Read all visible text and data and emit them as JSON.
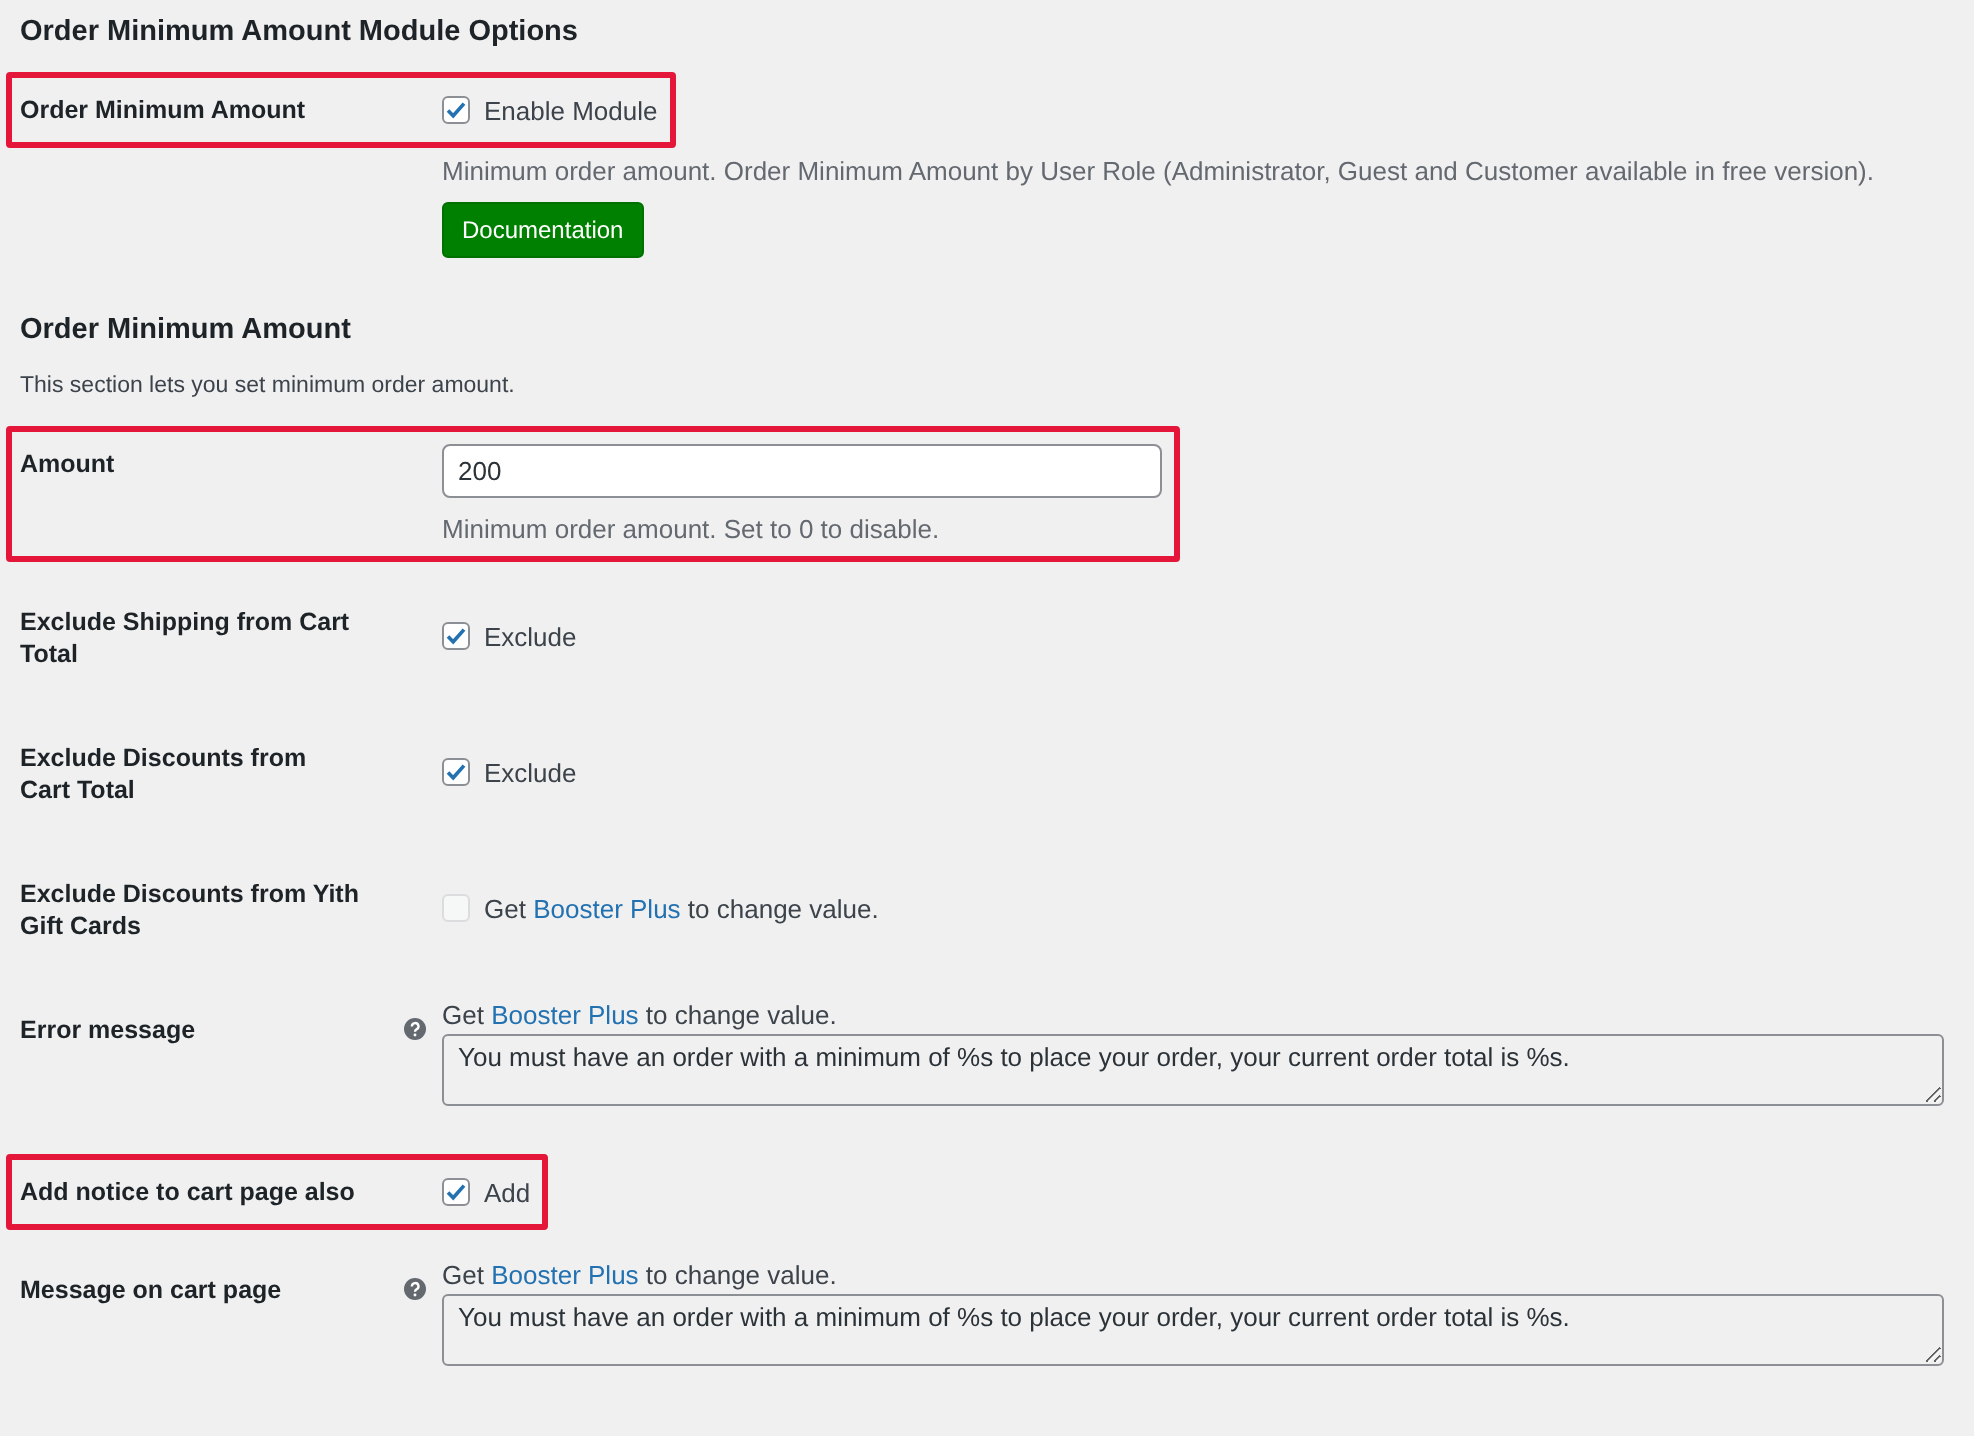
{
  "sections": [
    {
      "title": "Order Minimum Amount Module Options",
      "rows": [
        {
          "kind": "checkbox",
          "label": "Order Minimum Amount",
          "highlighted": true,
          "checked": true,
          "disabled": false,
          "option": "Enable Module",
          "description": "Minimum order amount. Order Minimum Amount by User Role (Administrator, Guest and Customer available in free version).",
          "button": "Documentation"
        }
      ]
    },
    {
      "title": "Order Minimum Amount",
      "description": "This section lets you set minimum order amount.",
      "rows": [
        {
          "kind": "input",
          "label": "Amount",
          "highlighted": true,
          "value": "200",
          "description": "Minimum order amount. Set to 0 to disable."
        },
        {
          "kind": "checkbox",
          "label": "Exclude Shipping from Cart Total",
          "highlighted": false,
          "checked": true,
          "disabled": false,
          "option": "Exclude"
        },
        {
          "kind": "checkbox",
          "label": "Exclude Discounts from Cart Total",
          "highlighted": false,
          "checked": true,
          "disabled": false,
          "option": "Exclude"
        },
        {
          "kind": "checkbox",
          "label": "Exclude Discounts from Yith Gift Cards",
          "highlighted": false,
          "checked": false,
          "disabled": true,
          "notice": {
            "before": "Get",
            "link": "Booster Plus",
            "after": "to change value."
          }
        },
        {
          "kind": "textarea",
          "label": "Error message",
          "highlighted": false,
          "help": true,
          "notice": {
            "before": "Get",
            "link": "Booster Plus",
            "after": "to change value."
          },
          "value": "You must have an order with a minimum of %s to place your order, your current order total is %s."
        },
        {
          "kind": "checkbox",
          "label": "Add notice to cart page also",
          "highlighted": true,
          "checked": true,
          "disabled": false,
          "option": "Add"
        },
        {
          "kind": "textarea",
          "label": "Message on cart page",
          "highlighted": false,
          "help": true,
          "notice": {
            "before": "Get",
            "link": "Booster Plus",
            "after": "to change value."
          },
          "value": "You must have an order with a minimum of %s to place your order, your current order total is %s."
        }
      ]
    }
  ]
}
